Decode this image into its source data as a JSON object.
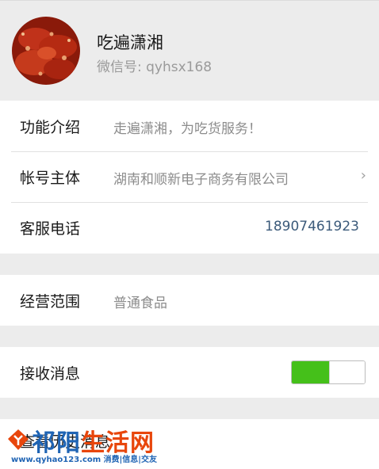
{
  "profile": {
    "name": "吃遍潇湘",
    "wechat_id": "微信号: qyhsx168"
  },
  "info_rows": [
    {
      "label": "功能介绍",
      "value": "走遍潇湘，为吃货服务！"
    },
    {
      "label": "帐号主体",
      "value": "湖南和顺新电子商务有限公司",
      "chevron": "›"
    },
    {
      "label": "客服电话",
      "value": "18907461923"
    }
  ],
  "business": {
    "label": "经营范围",
    "value": "普通食品"
  },
  "receive": {
    "label": "接收消息",
    "enabled": true
  },
  "history": {
    "label": "查看历史消息"
  },
  "watermark": {
    "title_part1": "祁阳",
    "title_part2": "生活网",
    "subtitle": "www.qyhao123.com 消费|信息|交友"
  },
  "colors": {
    "background": "#ececec",
    "toggle_on": "#45c01a",
    "phone_link": "#3b5a7a"
  }
}
